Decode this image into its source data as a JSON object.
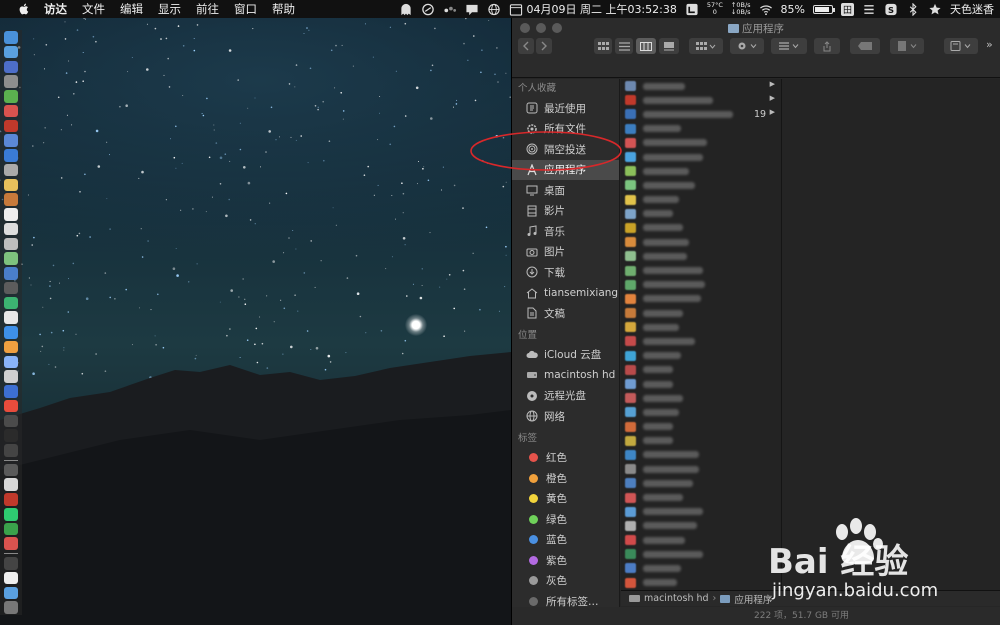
{
  "menubar": {
    "app_name": "访达",
    "items": [
      "文件",
      "编辑",
      "显示",
      "前往",
      "窗口",
      "帮助"
    ],
    "clock": "04月09日 周二 上午03:52:38",
    "net_up": "↑0B/s",
    "net_down": "↓0B/s",
    "temp_top": "57°C",
    "temp_bottom": "0",
    "battery_percent": "85%",
    "battery_level": 0.85,
    "input_method": "田",
    "user_name": "天色迷香"
  },
  "finder": {
    "window_title": "应用程序",
    "sidebar": {
      "favorites_title": "个人收藏",
      "favorites": [
        {
          "label": "最近使用",
          "icon": "clock-icon"
        },
        {
          "label": "所有文件",
          "icon": "gear-icon"
        },
        {
          "label": "隔空投送",
          "icon": "airdrop-icon"
        },
        {
          "label": "应用程序",
          "icon": "applications-icon",
          "selected": true
        },
        {
          "label": "桌面",
          "icon": "desktop-icon"
        },
        {
          "label": "影片",
          "icon": "film-icon"
        },
        {
          "label": "音乐",
          "icon": "music-icon"
        },
        {
          "label": "图片",
          "icon": "camera-icon"
        },
        {
          "label": "下载",
          "icon": "download-icon"
        },
        {
          "label": "tiansemixiang",
          "icon": "home-icon"
        },
        {
          "label": "文稿",
          "icon": "document-icon"
        }
      ],
      "locations_title": "位置",
      "locations": [
        {
          "label": "iCloud 云盘",
          "icon": "cloud-icon"
        },
        {
          "label": "macintosh hd",
          "icon": "harddisk-icon"
        },
        {
          "label": "远程光盘",
          "icon": "disc-icon"
        },
        {
          "label": "网络",
          "icon": "globe-icon"
        }
      ],
      "tags_title": "标签",
      "tags": [
        {
          "label": "红色",
          "color": "#e5534b"
        },
        {
          "label": "橙色",
          "color": "#f0a03c"
        },
        {
          "label": "黄色",
          "color": "#f2d43c"
        },
        {
          "label": "绿色",
          "color": "#6fd15a"
        },
        {
          "label": "蓝色",
          "color": "#4a90e2"
        },
        {
          "label": "紫色",
          "color": "#b36ae2"
        },
        {
          "label": "灰色",
          "color": "#9a9a9a"
        },
        {
          "label": "所有标签…",
          "color": "#6a6a6a"
        }
      ]
    },
    "partial_visible_text": "19",
    "pathbar": [
      "macintosh hd",
      "应用程序"
    ],
    "statusbar": "222 项，51.7 GB 可用"
  },
  "watermark": {
    "brand": "Bai  经验",
    "url": "jingyan.baidu.com"
  }
}
